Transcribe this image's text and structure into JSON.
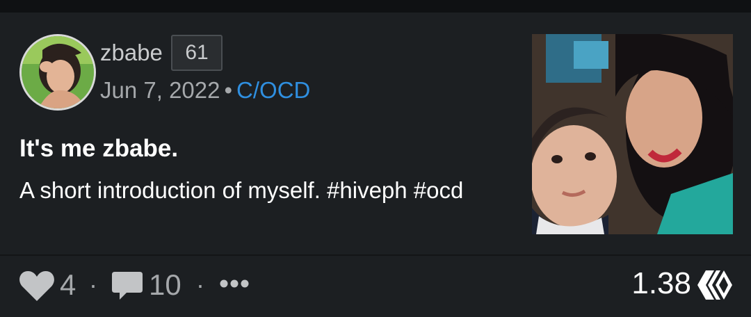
{
  "post": {
    "author": "zbabe",
    "reputation": "61",
    "date": "Jun 7, 2022",
    "separator": "•",
    "community": "C/OCD",
    "title": "It's me zbabe.",
    "summary": "A short introduction of myself. #hiveph #ocd"
  },
  "footer": {
    "votes": "4",
    "comments": "10",
    "separator": "·",
    "payout": "1.38"
  },
  "icons": {
    "vote": "heart-icon",
    "comments": "comment-icon",
    "more": "more-dots-icon",
    "currency": "hive-logo-icon"
  },
  "colors": {
    "background": "#1c1f22",
    "community_link": "#2f8fe0",
    "muted_text": "#a5a8ab"
  }
}
